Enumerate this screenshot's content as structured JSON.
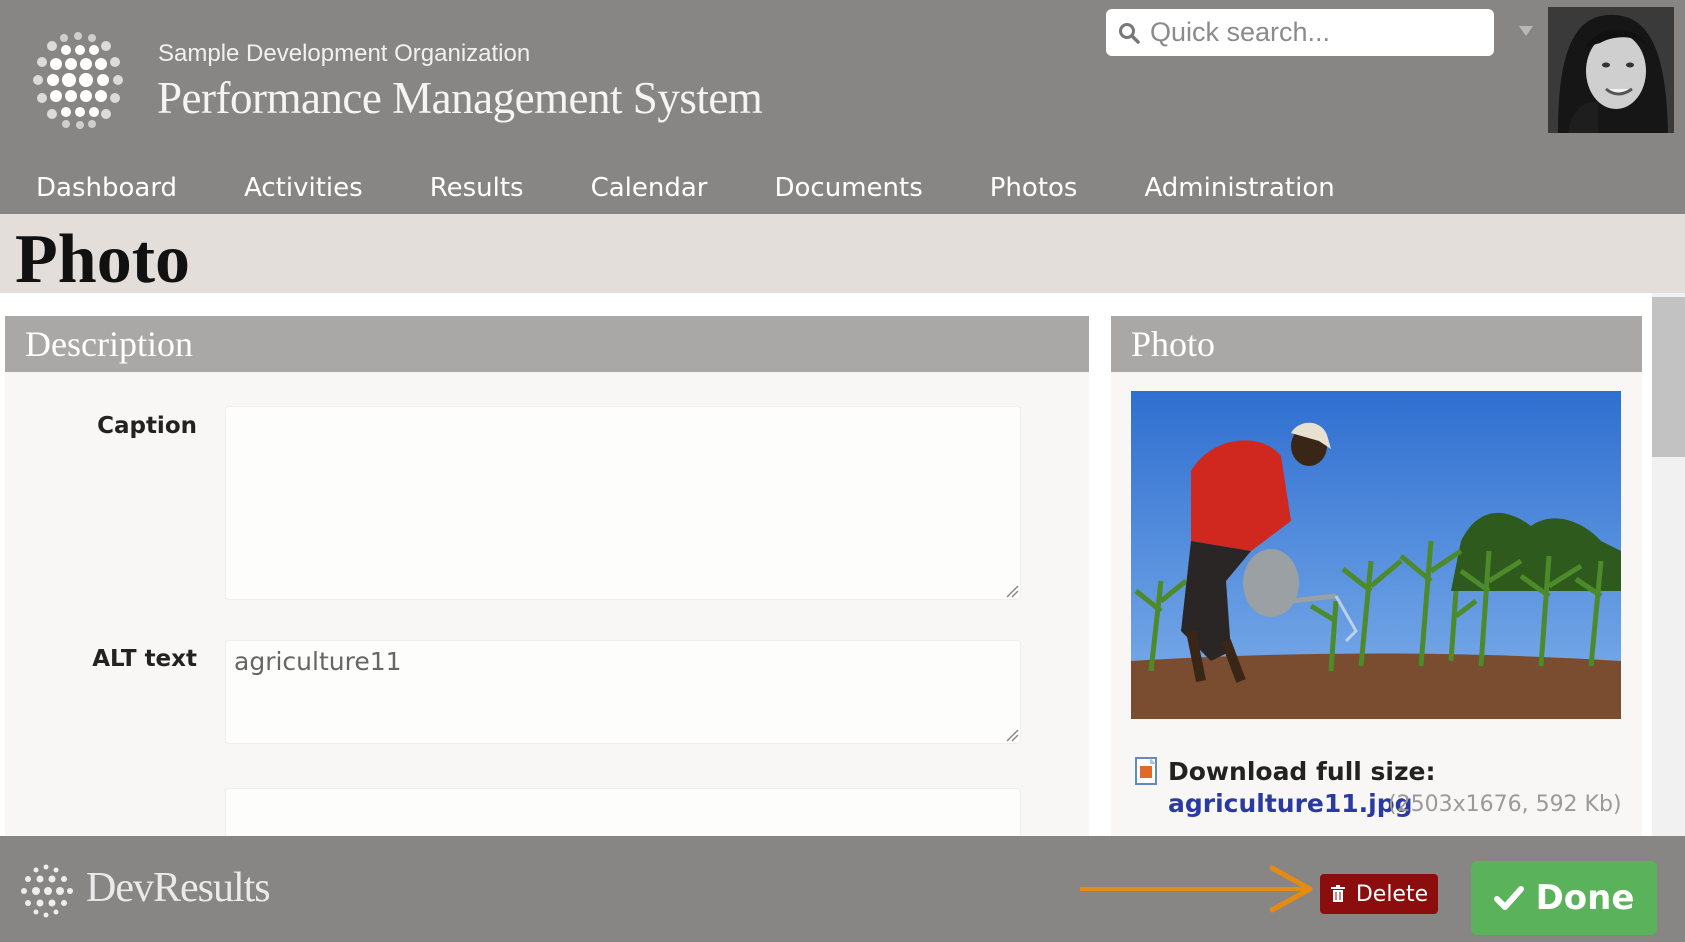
{
  "header": {
    "org_name": "Sample Development Organization",
    "app_title": "Performance Management System",
    "logo_icon": "globe-dots-icon",
    "search": {
      "placeholder": "Quick search..."
    }
  },
  "nav": {
    "items": [
      {
        "label": "Dashboard"
      },
      {
        "label": "Activities"
      },
      {
        "label": "Results"
      },
      {
        "label": "Calendar"
      },
      {
        "label": "Documents"
      },
      {
        "label": "Photos"
      },
      {
        "label": "Administration"
      }
    ]
  },
  "page": {
    "title": "Photo"
  },
  "description_panel": {
    "heading": "Description",
    "caption_label": "Caption",
    "caption_value": "",
    "alt_label": "ALT text",
    "alt_value": "agriculture11"
  },
  "photo_panel": {
    "heading": "Photo",
    "download_label": "Download full size:",
    "file_name": "agriculture11.jpg",
    "file_meta": "(2503x1676, 592 Kb)"
  },
  "footer": {
    "brand": "DevResults",
    "delete_label": "Delete",
    "done_label": "Done"
  },
  "colors": {
    "header_bg": "#878685",
    "title_bar_bg": "#e4deda",
    "panel_head_bg": "#a9a8a7",
    "delete_bg": "#8b0d0d",
    "done_bg": "#5ab25a",
    "annotation_arrow": "#e58a12",
    "link": "#2a3aa0"
  }
}
